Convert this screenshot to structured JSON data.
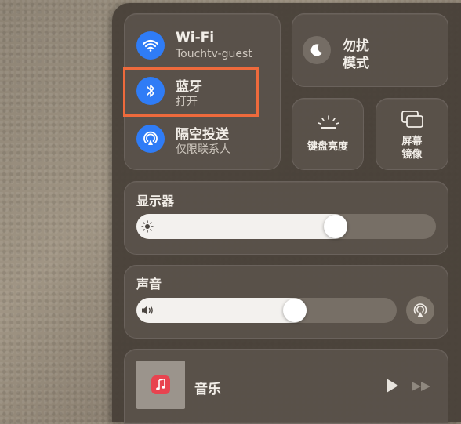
{
  "connectivity": {
    "wifi": {
      "label": "Wi-Fi",
      "status": "Touchtv-guest",
      "icon": "wifi-icon"
    },
    "bluetooth": {
      "label": "蓝牙",
      "status": "打开",
      "icon": "bluetooth-icon"
    },
    "airdrop": {
      "label": "隔空投送",
      "status": "仅限联系人",
      "icon": "airdrop-icon"
    }
  },
  "focus": {
    "label_line1": "勿扰",
    "label_line2": "模式",
    "icon": "moon-icon"
  },
  "keyboard_brightness": {
    "label": "键盘亮度",
    "icon": "keyboard-brightness-icon"
  },
  "screen_mirroring": {
    "label_line1": "屏幕",
    "label_line2": "镜像",
    "icon": "screen-mirroring-icon"
  },
  "display": {
    "title": "显示器",
    "brightness_level": 0.68,
    "icon": "sun-icon"
  },
  "sound": {
    "title": "声音",
    "volume_level": 0.62,
    "icon": "speaker-icon",
    "airplay_icon": "airplay-audio-icon"
  },
  "now_playing": {
    "app": "音乐",
    "icon": "music-note-icon",
    "controls": [
      "play-icon",
      "forward-icon"
    ]
  },
  "colors": {
    "accent": "#2f7cf6",
    "highlight": "#ee6a3c",
    "music_icon_bg": "#e8434f"
  }
}
